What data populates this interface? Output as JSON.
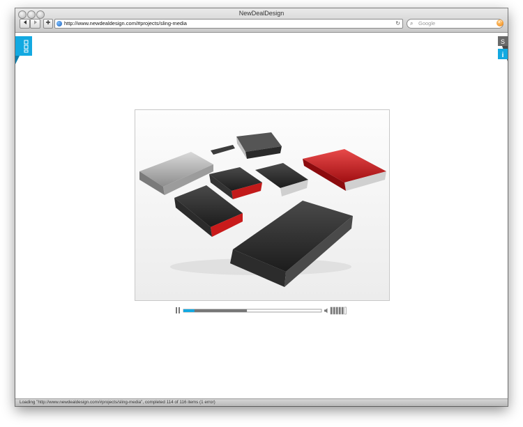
{
  "window": {
    "title": "NewDealDesign"
  },
  "toolbar": {
    "back_icon": "back-arrow-icon",
    "forward_icon": "forward-arrow-icon",
    "add_bookmark_icon": "plus-icon",
    "url": "http://www.newdealdesign.com/#projects/sling-media",
    "search_placeholder": "Google",
    "reload_icon": "reload-icon",
    "snapback_icon": "snapback-icon"
  },
  "site": {
    "right_tab_s_label": "S",
    "right_tab_i_label": "i",
    "accent_color": "#13a9e1",
    "menu_icon": "menu-grid-icon",
    "player": {
      "pause_icon": "pause-icon",
      "volume_icon": "speaker-icon",
      "played_fraction": 0.08,
      "loaded_fraction": 0.46,
      "volume_bars": 6,
      "volume_level": 5
    }
  },
  "status": {
    "text": "Loading \"http://www.newdealdesign.com/#projects/sling-media\", completed 114 of 116 items (1 error)"
  }
}
